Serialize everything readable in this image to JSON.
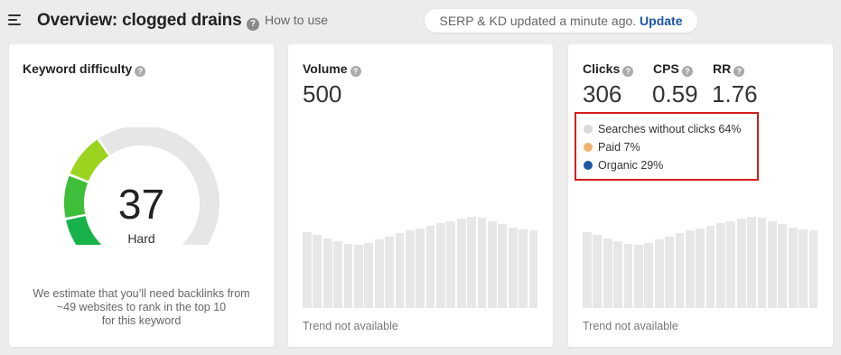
{
  "header": {
    "title": "Overview: clogged drains",
    "how_to": "How to use",
    "serp_status": "SERP & KD updated a minute ago.",
    "update_label": "Update"
  },
  "kd_card": {
    "title": "Keyword difficulty",
    "value": "37",
    "rating": "Hard",
    "note_line1": "We estimate that you’ll need backlinks from",
    "note_line2": "~49 websites to rank in the top 10",
    "note_line3": "for this keyword",
    "gauge_fill_fraction": 0.37,
    "colors": {
      "filled_dark": "#17b24a",
      "filled_light": "#9bd31e",
      "empty": "#e6e6e6"
    }
  },
  "volume_card": {
    "title": "Volume",
    "value": "500",
    "trend_text": "Trend not available"
  },
  "clicks_card": {
    "metrics": [
      {
        "label": "Clicks",
        "value": "306"
      },
      {
        "label": "CPS",
        "value": "0.59"
      },
      {
        "label": "RR",
        "value": "1.76"
      }
    ],
    "breakdown": [
      {
        "label": "Searches without clicks 64%",
        "color": "#d9d9d9"
      },
      {
        "label": "Paid 7%",
        "color": "#f2b26c"
      },
      {
        "label": "Organic 29%",
        "color": "#1d56a6"
      }
    ],
    "trend_text": "Trend not available"
  },
  "placeholder_trend_levels": [
    0.93,
    0.9,
    0.86,
    0.82,
    0.79,
    0.78,
    0.8,
    0.84,
    0.88,
    0.92,
    0.95,
    0.98,
    1.01,
    1.04,
    1.07,
    1.1,
    1.12,
    1.11,
    1.07,
    1.03,
    0.99,
    0.97,
    0.96
  ]
}
